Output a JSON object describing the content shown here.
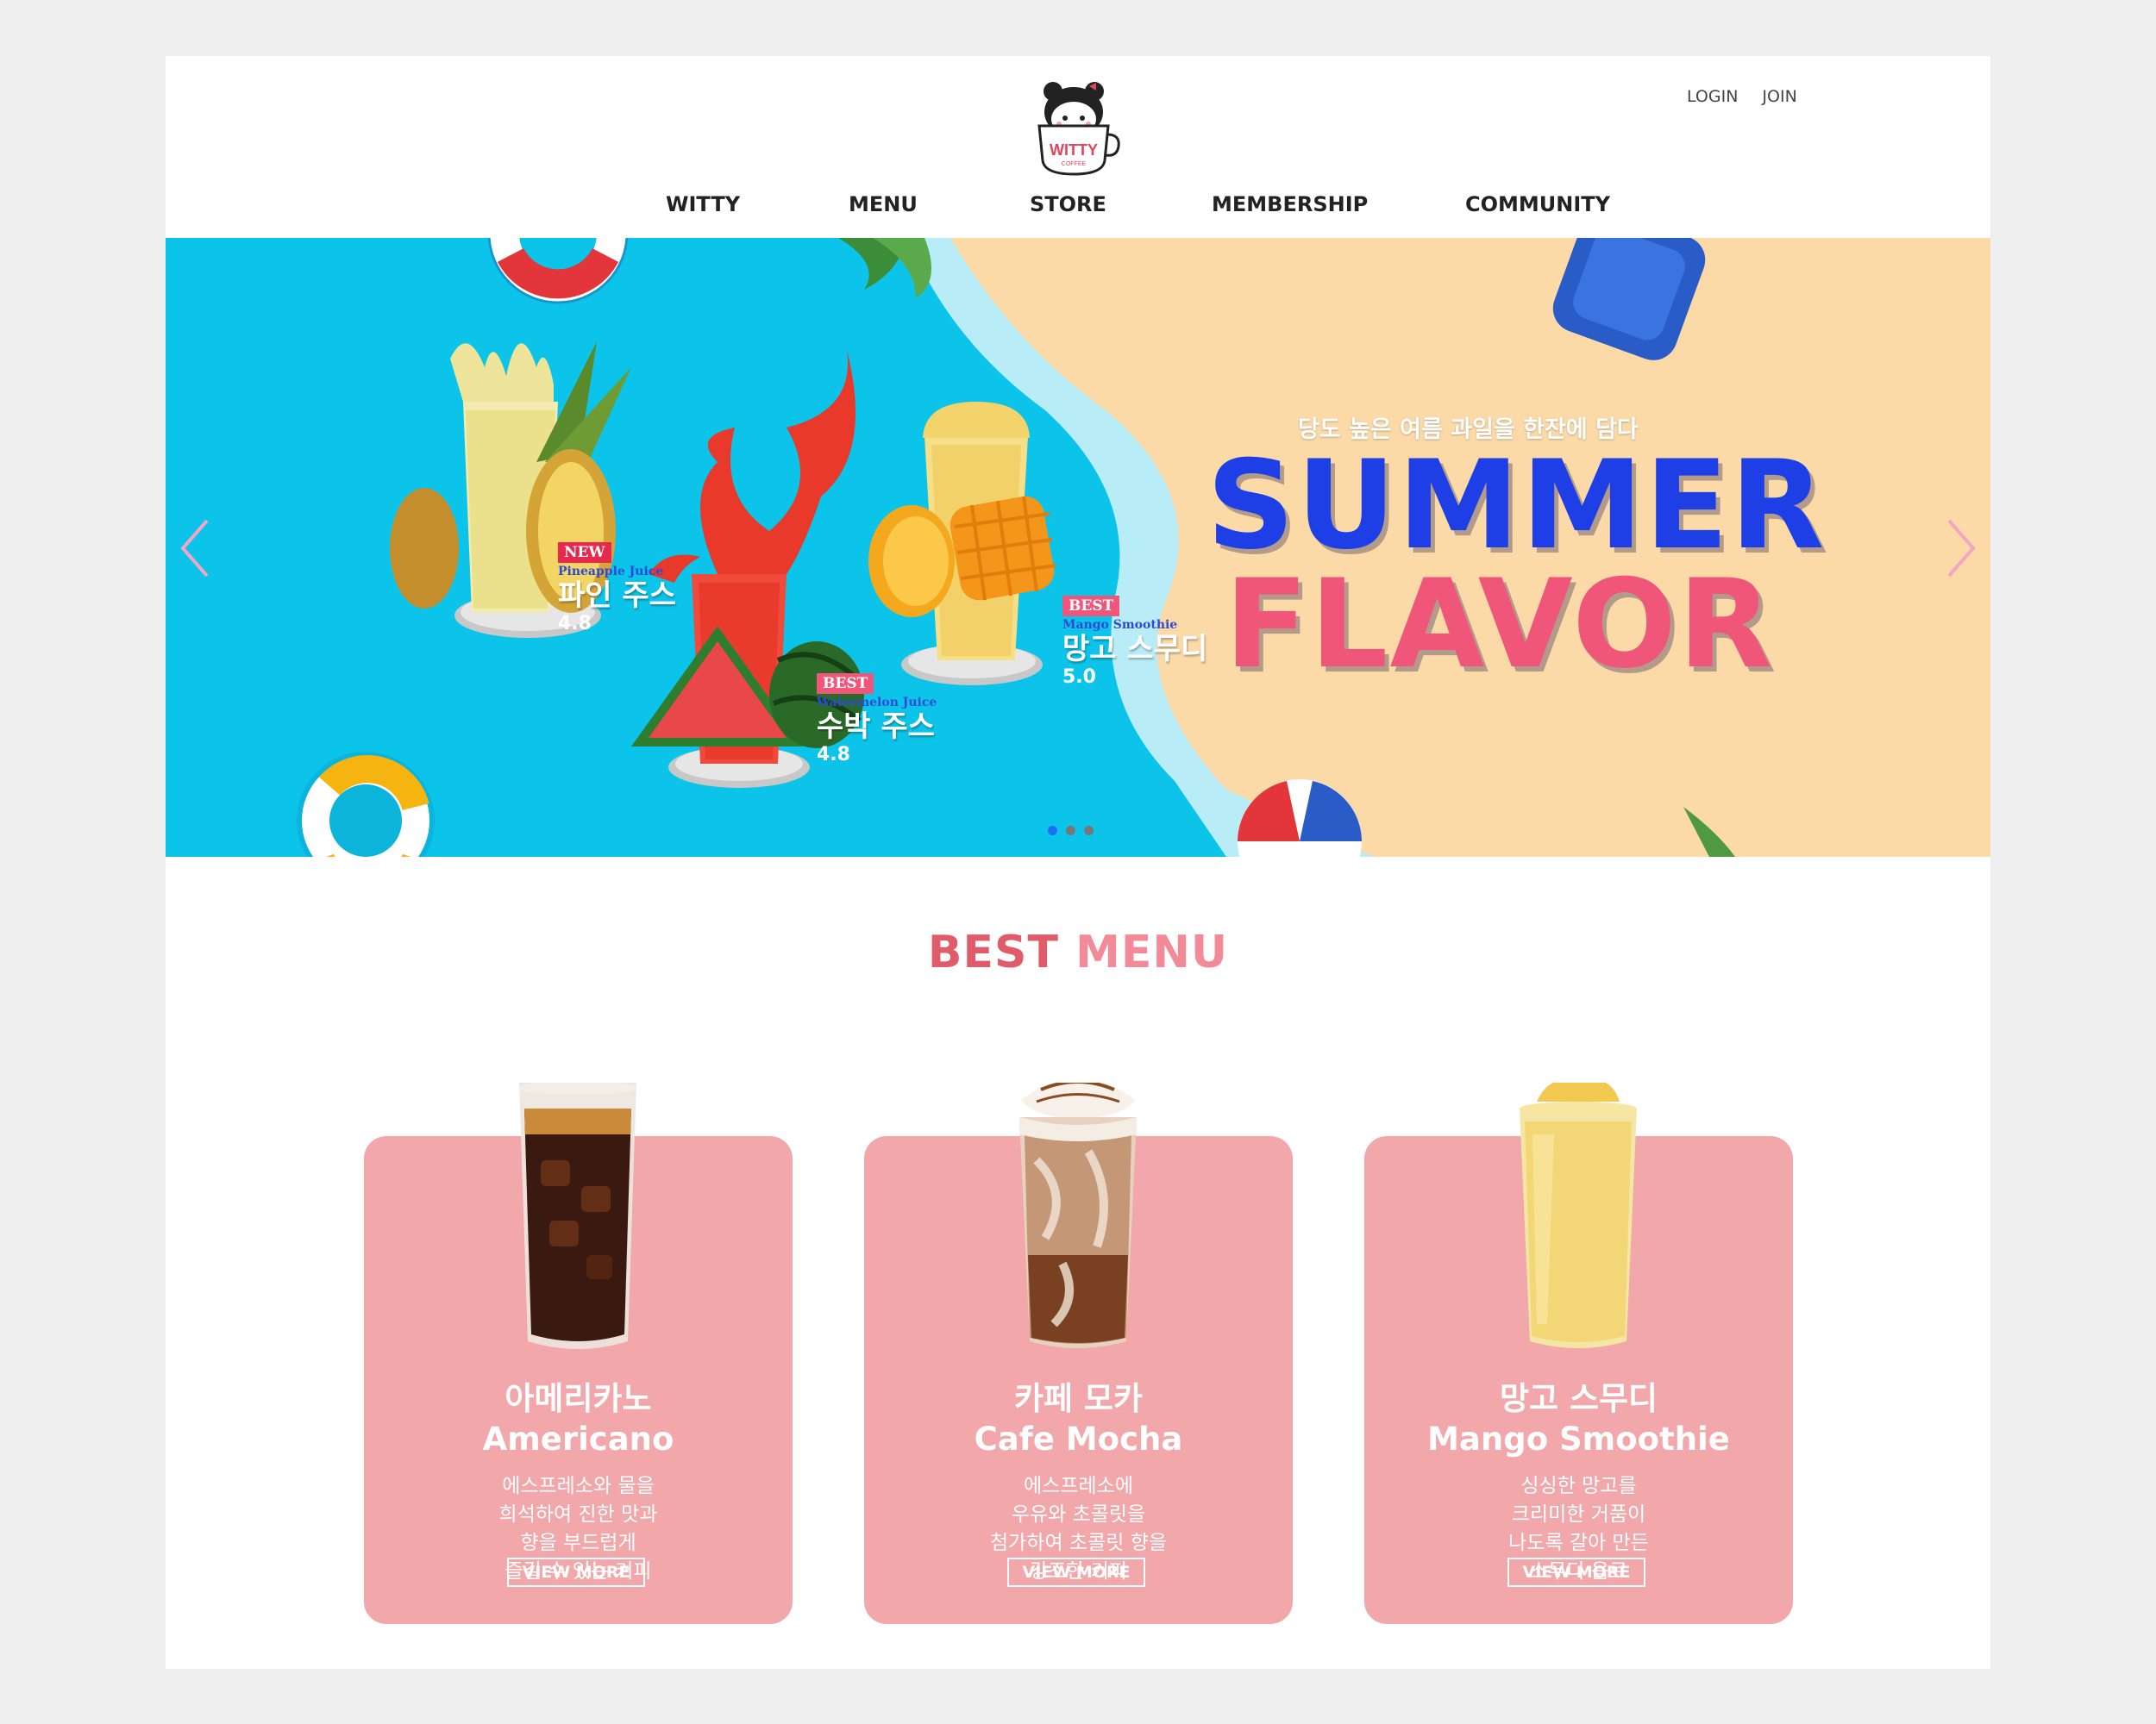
{
  "header": {
    "logo_text": "WITTY",
    "logo_subtext": "COFFEE",
    "util_links": [
      "LOGIN",
      "JOIN"
    ],
    "nav": [
      "WITTY",
      "MENU",
      "STORE",
      "MEMBERSHIP",
      "COMMUNITY"
    ]
  },
  "hero": {
    "subtitle": "당도 높은 여름 과일을 한잔에 담다",
    "title_line1": "SUMMER",
    "title_line2": "FLAVOR",
    "products": [
      {
        "badge": "NEW",
        "name_en": "Pineapple Juice",
        "name_ko": "파인 주스",
        "score": "4.8"
      },
      {
        "badge": "BEST",
        "name_en": "Watermelon Juice",
        "name_ko": "수박 주스",
        "score": "4.8"
      },
      {
        "badge": "BEST",
        "name_en": "Mango Smoothie",
        "name_ko": "망고 스무디",
        "score": "5.0"
      }
    ],
    "slide_count": 3,
    "active_slide": 1,
    "colors": {
      "sea": "#0cc3ea",
      "sand": "#fcdaa8",
      "title_blue": "#1f3fe6",
      "title_pink": "#f0557a"
    }
  },
  "best_menu": {
    "title_word1": "BEST",
    "title_word2": "MENU",
    "items": [
      {
        "name_ko": "아메리카노",
        "name_en": "Americano",
        "desc": [
          "에스프레소와 물을",
          "희석하여 진한 맛과",
          "향을 부드럽게",
          "즐길 수 있는 커피"
        ],
        "button": "VIEW MORE"
      },
      {
        "name_ko": "카페 모카",
        "name_en": "Cafe Mocha",
        "desc": [
          "에스프레소에",
          "우유와 초콜릿을",
          "첨가하여 초콜릿 향을",
          "강조한 커피"
        ],
        "button": "VIEW MORE"
      },
      {
        "name_ko": "망고 스무디",
        "name_en": "Mango Smoothie",
        "desc": [
          "싱싱한 망고를",
          "크리미한 거품이",
          "나도록 갈아 만든",
          "스무디 음료"
        ],
        "button": "VIEW MORE"
      }
    ],
    "card_color": "#f2a7aa"
  }
}
